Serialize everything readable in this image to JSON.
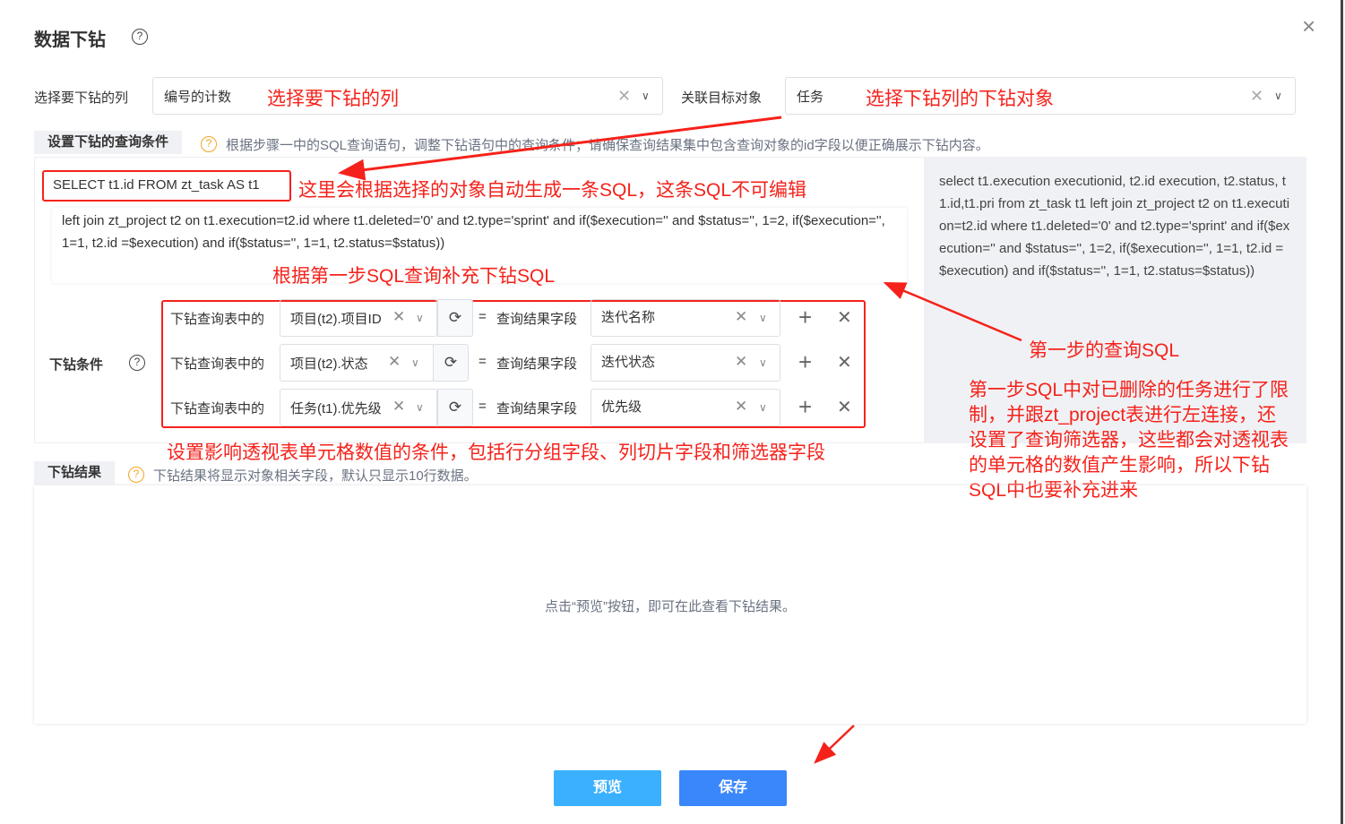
{
  "dialog": {
    "title": "数据下钻",
    "close": "×"
  },
  "column_select": {
    "label": "选择要下钻的列",
    "value": "编号的计数",
    "annotation": "选择要下钻的列"
  },
  "target_select": {
    "label": "关联目标对象",
    "value": "任务",
    "annotation": "选择下钻列的下钻对象"
  },
  "query_section": {
    "tab": "设置下钻的查询条件",
    "hint": "根据步骤一中的SQL查询语句，调整下钻语句中的查询条件；请确保查询结果集中包含查询对象的id字段以便正确展示下钻内容。",
    "select_prefix": "SELECT t1.id FROM zt_task AS t1",
    "select_annotation": "这里会根据选择的对象自动生成一条SQL，这条SQL不可编辑",
    "sql_body": "left join zt_project t2 on t1.execution=t2.id where t1.deleted='0' and t2.type='sprint' and if($execution='' and $status='', 1=2, if($execution='', 1=1, t2.id =$execution) and if($status='', 1=1, t2.status=$status))",
    "sql_annotation": "根据第一步SQL查询补充下钻SQL",
    "reference_sql": "select t1.execution executionid, t2.id execution, t2.status, t1.id,t1.pri from zt_task t1 left join zt_project t2 on t1.execution=t2.id where t1.deleted='0' and t2.type='sprint' and if($execution='' and $status='', 1=2, if($execution='', 1=1, t2.id =$execution) and if($status='', 1=1, t2.status=$status))",
    "reference_annotation": "第一步的查询SQL",
    "reference_note": "第一步SQL中对已删除的任务进行了限制，并跟zt_project表进行左连接，还设置了查询筛选器，这些都会对透视表的单元格的数值产生影响，所以下钻SQL中也要补充进来"
  },
  "conditions": {
    "label": "下钻条件",
    "annotation": "设置影响透视表单元格数值的条件，包括行分组字段、列切片字段和筛选器字段",
    "rows": [
      {
        "prefix": "下钻查询表中的",
        "field": "项目(t2).项目ID",
        "eq": "=",
        "result_label": "查询结果字段",
        "result": "迭代名称"
      },
      {
        "prefix": "下钻查询表中的",
        "field": "项目(t2).状态",
        "eq": "=",
        "result_label": "查询结果字段",
        "result": "迭代状态"
      },
      {
        "prefix": "下钻查询表中的",
        "field": "任务(t1).优先级",
        "eq": "=",
        "result_label": "查询结果字段",
        "result": "优先级"
      }
    ]
  },
  "result_section": {
    "tab": "下钻结果",
    "hint": "下钻结果将显示对象相关字段，默认只显示10行数据。",
    "empty": "点击“预览”按钮，即可在此查看下钻结果。"
  },
  "buttons": {
    "preview": "预览",
    "save": "保存"
  },
  "colors": {
    "annotation": "#f5221b",
    "preview": "#3ab0fe",
    "save": "#3a86fb"
  }
}
